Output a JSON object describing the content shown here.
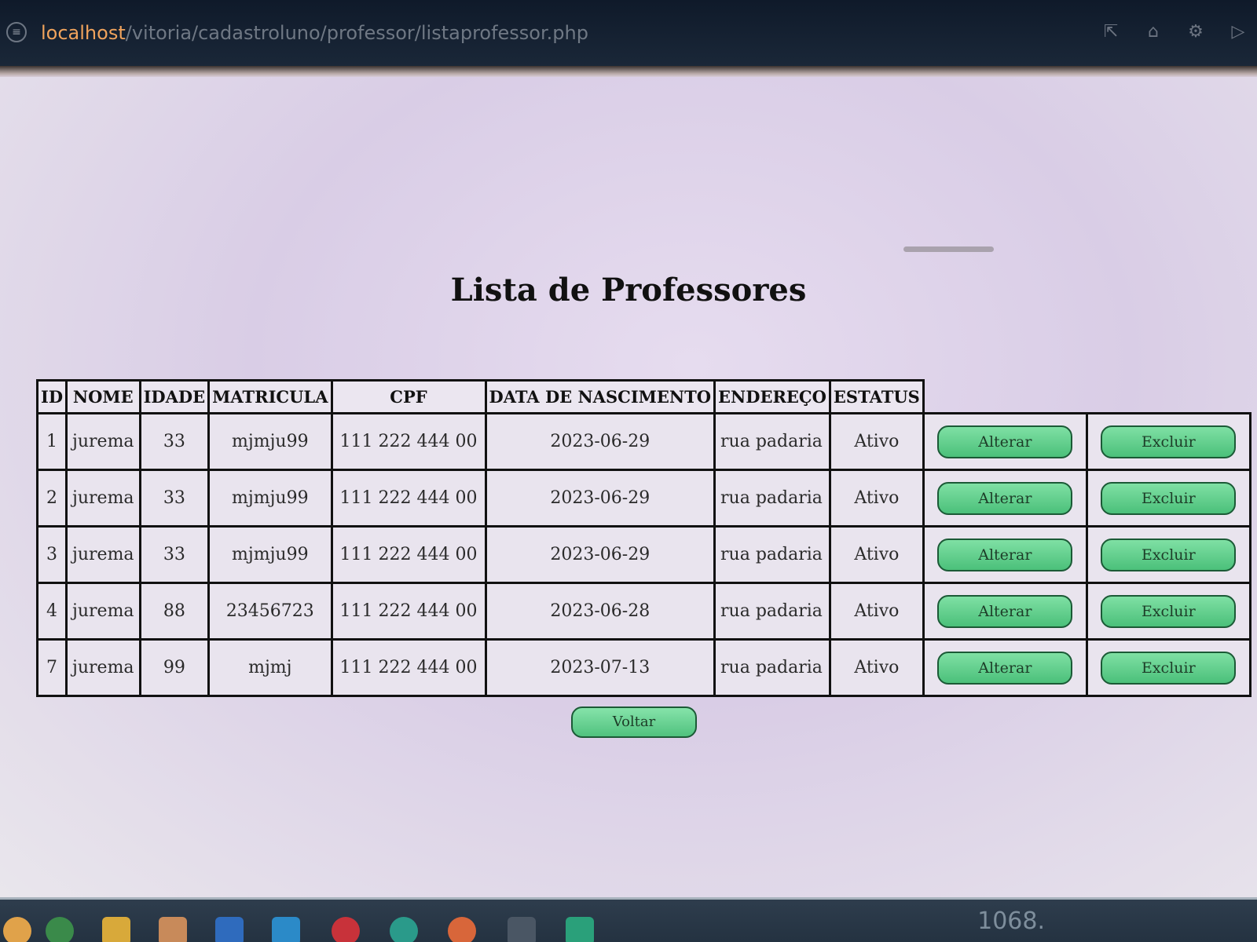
{
  "browser": {
    "url_host": "localhost",
    "url_path": "/vitoria/cadastroluno/professor/listaprofessor.php"
  },
  "page": {
    "title": "Lista de Professores",
    "back_label": "Voltar"
  },
  "table": {
    "headers": [
      "ID",
      "NOME",
      "IDADE",
      "MATRICULA",
      "CPF",
      "DATA DE NASCIMENTO",
      "ENDEREÇO",
      "ESTATUS"
    ],
    "rows": [
      {
        "id": "1",
        "nome": "jurema",
        "idade": "33",
        "matricula": "mjmju99",
        "cpf": "111 222 444 00",
        "nascimento": "2023-06-29",
        "endereco": "rua padaria",
        "status": "Ativo"
      },
      {
        "id": "2",
        "nome": "jurema",
        "idade": "33",
        "matricula": "mjmju99",
        "cpf": "111 222 444 00",
        "nascimento": "2023-06-29",
        "endereco": "rua padaria",
        "status": "Ativo"
      },
      {
        "id": "3",
        "nome": "jurema",
        "idade": "33",
        "matricula": "mjmju99",
        "cpf": "111 222 444 00",
        "nascimento": "2023-06-29",
        "endereco": "rua padaria",
        "status": "Ativo"
      },
      {
        "id": "4",
        "nome": "jurema",
        "idade": "88",
        "matricula": "23456723",
        "cpf": "111 222 444 00",
        "nascimento": "2023-06-28",
        "endereco": "rua padaria",
        "status": "Ativo"
      },
      {
        "id": "7",
        "nome": "jurema",
        "idade": "99",
        "matricula": "mjmj",
        "cpf": "111 222 444 00",
        "nascimento": "2023-07-13",
        "endereco": "rua padaria",
        "status": "Ativo"
      }
    ],
    "alter_label": "Alterar",
    "delete_label": "Excluir"
  },
  "taskbar": {
    "clock_fragment": "1068."
  },
  "colors": {
    "button_green": "#4bc07a",
    "address_bar": "#0f1a2a",
    "url_host": "#f0a35c"
  }
}
